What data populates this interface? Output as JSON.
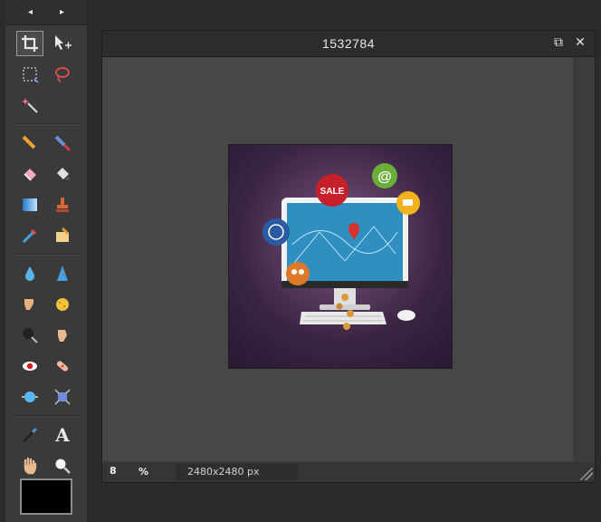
{
  "toolbox": {
    "nav_left": "◂",
    "nav_right": "▸",
    "tools": [
      [
        "crop-icon",
        "move-icon"
      ],
      [
        "marquee-select-icon",
        "lasso-icon"
      ],
      [
        "magic-wand-icon"
      ],
      [
        "pencil-icon",
        "brush-icon"
      ],
      [
        "eraser-icon",
        "fill-bucket-icon"
      ],
      [
        "gradient-icon",
        "clone-stamp-icon"
      ],
      [
        "color-replace-icon",
        "smudge-drawing-icon"
      ],
      [
        "blur-drop-icon",
        "sharpen-icon"
      ],
      [
        "smudge-finger-icon",
        "sponge-icon"
      ],
      [
        "burn-icon",
        "dodge-icon"
      ],
      [
        "red-eye-icon",
        "spot-heal-icon"
      ],
      [
        "bloat-icon",
        "pinch-icon"
      ],
      [
        "color-picker-icon",
        "text-tool-icon"
      ],
      [
        "hand-icon",
        "zoom-icon"
      ]
    ],
    "text_tool_glyph": "A",
    "foreground_color": "#000000"
  },
  "document": {
    "title": "1532784",
    "restore_glyph": "⧉",
    "close_glyph": "✕"
  },
  "status": {
    "zoom_value": "8",
    "zoom_unit": "%",
    "dimensions": "2480x2480 px"
  },
  "image_content": {
    "sale_badge": "SALE",
    "at_symbol": "@"
  },
  "colors": {
    "app_background": "#2b2b2b",
    "canvas_background": "#474747",
    "image_background": "#3a2443"
  }
}
